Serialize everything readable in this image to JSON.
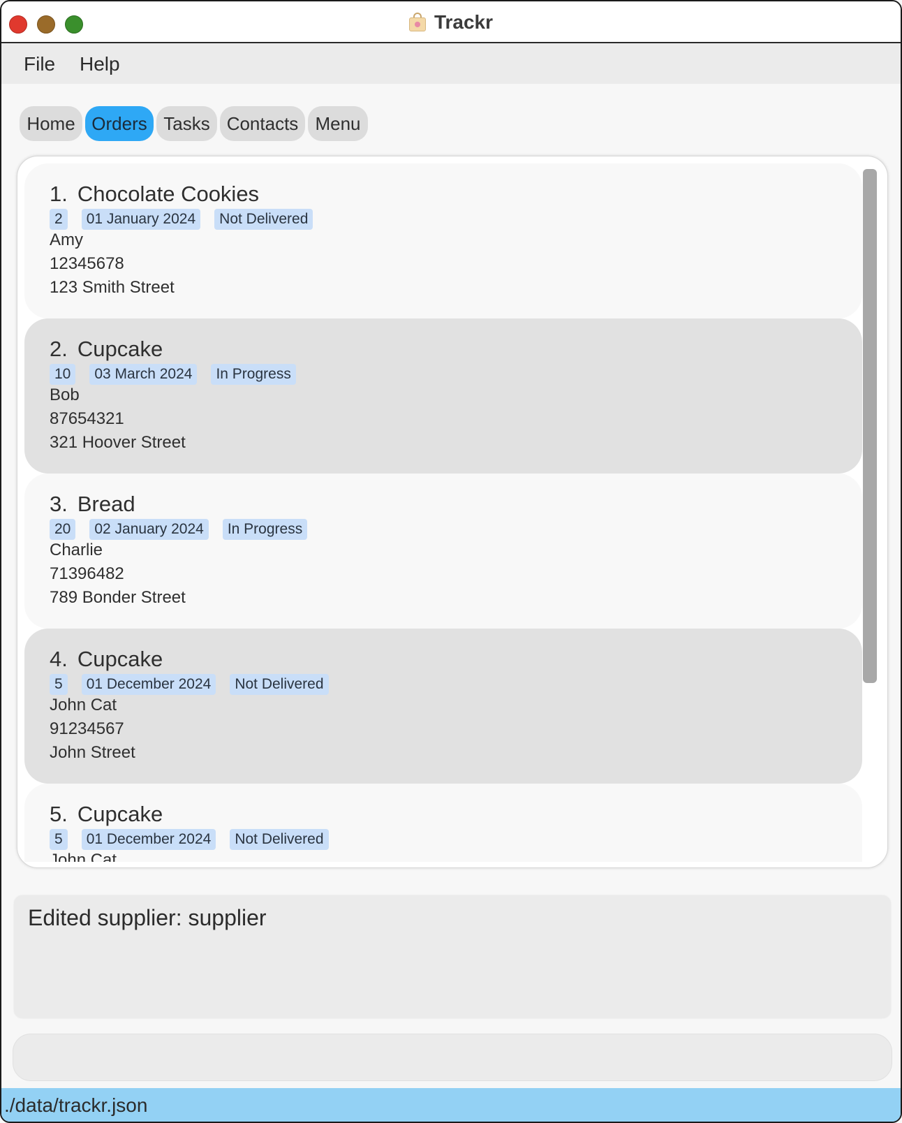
{
  "window": {
    "title": "Trackr",
    "icon": "shopping-bag-icon"
  },
  "menu": {
    "items": [
      {
        "label": "File"
      },
      {
        "label": "Help"
      }
    ]
  },
  "tabs": [
    {
      "label": "Home",
      "active": false
    },
    {
      "label": "Orders",
      "active": true
    },
    {
      "label": "Tasks",
      "active": false
    },
    {
      "label": "Contacts",
      "active": false
    },
    {
      "label": "Menu",
      "active": false
    }
  ],
  "orders": [
    {
      "index": "1.",
      "name": "Chocolate Cookies",
      "quantity": "2",
      "date": "01 January 2024",
      "status": "Not Delivered",
      "customer": "Amy",
      "phone": "12345678",
      "address": "123 Smith Street"
    },
    {
      "index": "2.",
      "name": "Cupcake",
      "quantity": "10",
      "date": "03 March 2024",
      "status": "In Progress",
      "customer": "Bob",
      "phone": "87654321",
      "address": "321 Hoover Street"
    },
    {
      "index": "3.",
      "name": "Bread",
      "quantity": "20",
      "date": "02 January 2024",
      "status": "In Progress",
      "customer": "Charlie",
      "phone": "71396482",
      "address": "789 Bonder Street"
    },
    {
      "index": "4.",
      "name": "Cupcake",
      "quantity": "5",
      "date": "01 December 2024",
      "status": "Not Delivered",
      "customer": "John Cat",
      "phone": "91234567",
      "address": "John Street"
    },
    {
      "index": "5.",
      "name": "Cupcake",
      "quantity": "5",
      "date": "01 December 2024",
      "status": "Not Delivered",
      "customer": "John Cat",
      "phone": "",
      "address": ""
    }
  ],
  "result": {
    "message": "Edited supplier: supplier"
  },
  "command": {
    "value": "",
    "placeholder": ""
  },
  "status": {
    "path": "./data/trackr.json"
  },
  "colors": {
    "active_tab": "#2ea8f5",
    "tag_bg": "#c9def8",
    "status_bar": "#93d1f4",
    "close": "#e0392e",
    "minimize": "#9a6b2a",
    "maximize": "#3a8f2c"
  }
}
